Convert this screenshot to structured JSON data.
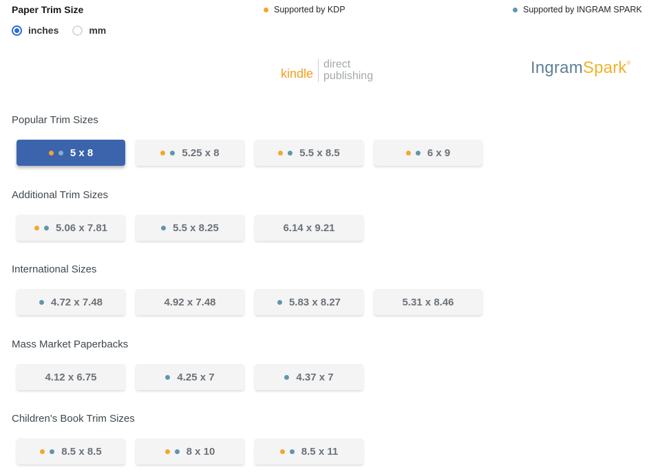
{
  "header": {
    "title": "Paper Trim Size",
    "units": {
      "options": [
        {
          "label": "inches",
          "selected": true
        },
        {
          "label": "mm",
          "selected": false
        }
      ]
    },
    "legend": [
      {
        "label": "Supported by KDP",
        "color": "#f5a62b"
      },
      {
        "label": "Supported by INGRAM SPARK",
        "color": "#6095b0"
      }
    ]
  },
  "logos": {
    "kdp": {
      "kindle": "kindle",
      "line1": "direct",
      "line2": "publishing"
    },
    "ingram": {
      "ingram": "Ingram",
      "spark": "Spark",
      "mark": "®"
    }
  },
  "colors": {
    "selected_blue": "#3b64ad",
    "radio_blue": "#2a6bd2",
    "kdp_orange": "#f5a62b",
    "kdp_orange_logo": "#f79c1d",
    "ingram_blue": "#6095b0",
    "ingram_slate": "#5d7f95",
    "spark_gold": "#efb32b"
  },
  "sections": [
    {
      "label": "Popular Trim Sizes",
      "sizes": [
        {
          "label": "5 x 8",
          "kdp": true,
          "ingram": true,
          "selected": true
        },
        {
          "label": "5.25 x 8",
          "kdp": true,
          "ingram": true,
          "selected": false
        },
        {
          "label": "5.5 x 8.5",
          "kdp": true,
          "ingram": true,
          "selected": false
        },
        {
          "label": "6 x 9",
          "kdp": true,
          "ingram": true,
          "selected": false
        }
      ]
    },
    {
      "label": "Additional Trim Sizes",
      "sizes": [
        {
          "label": "5.06 x 7.81",
          "kdp": true,
          "ingram": true,
          "selected": false
        },
        {
          "label": "5.5 x 8.25",
          "kdp": false,
          "ingram": true,
          "selected": false
        },
        {
          "label": "6.14 x 9.21",
          "kdp": false,
          "ingram": false,
          "selected": false
        }
      ]
    },
    {
      "label": "International Sizes",
      "sizes": [
        {
          "label": "4.72 x 7.48",
          "kdp": false,
          "ingram": true,
          "selected": false
        },
        {
          "label": "4.92 x 7.48",
          "kdp": false,
          "ingram": false,
          "selected": false
        },
        {
          "label": "5.83 x 8.27",
          "kdp": false,
          "ingram": true,
          "selected": false
        },
        {
          "label": "5.31 x 8.46",
          "kdp": false,
          "ingram": false,
          "selected": false
        }
      ]
    },
    {
      "label": "Mass Market Paperbacks",
      "sizes": [
        {
          "label": "4.12 x 6.75",
          "kdp": false,
          "ingram": false,
          "selected": false
        },
        {
          "label": "4.25 x 7",
          "kdp": false,
          "ingram": true,
          "selected": false
        },
        {
          "label": "4.37 x 7",
          "kdp": false,
          "ingram": true,
          "selected": false
        }
      ]
    },
    {
      "label": "Children's Book Trim Sizes",
      "sizes": [
        {
          "label": "8.5 x 8.5",
          "kdp": true,
          "ingram": true,
          "selected": false
        },
        {
          "label": "8 x 10",
          "kdp": true,
          "ingram": true,
          "selected": false
        },
        {
          "label": "8.5 x 11",
          "kdp": true,
          "ingram": true,
          "selected": false
        }
      ]
    }
  ]
}
